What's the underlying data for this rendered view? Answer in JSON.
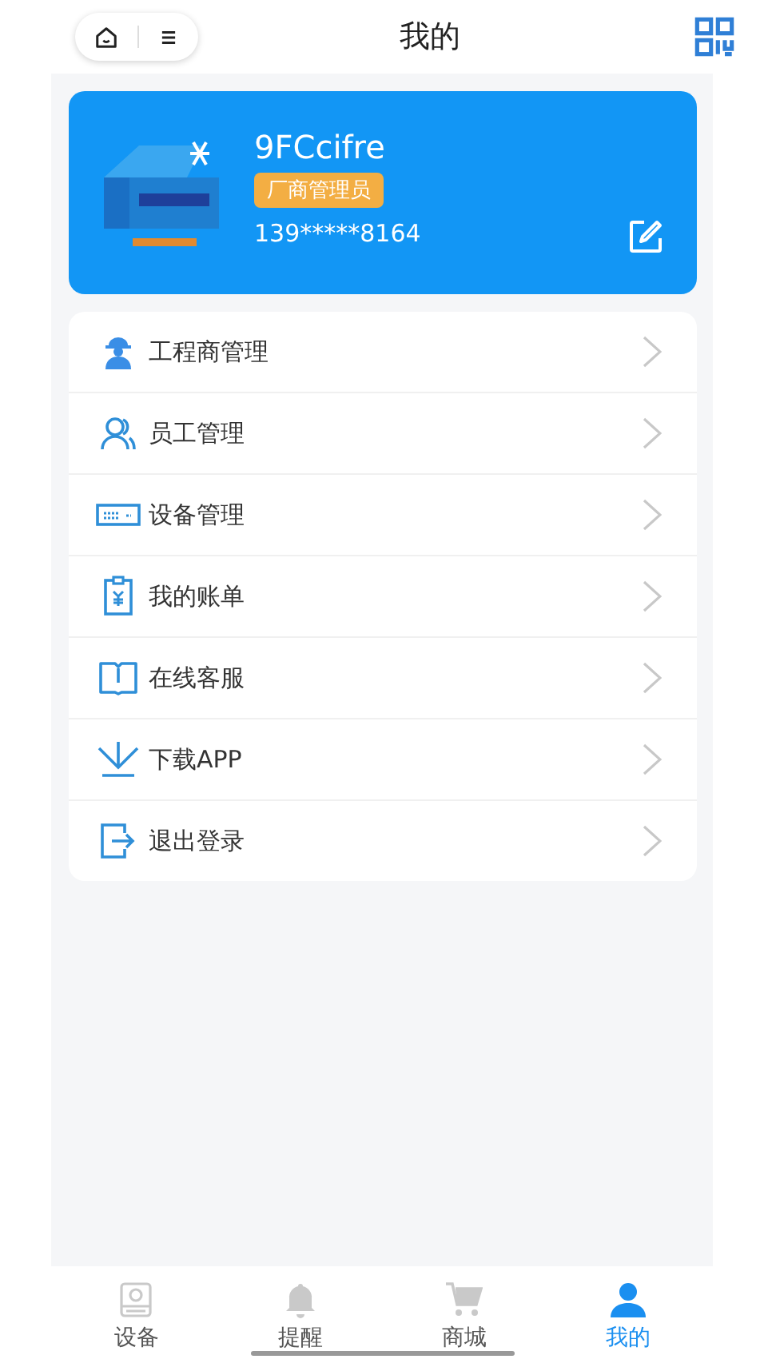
{
  "header": {
    "title": "我的"
  },
  "profile": {
    "name": "9FCcifre",
    "role": "厂商管理员",
    "phone": "139*****8164"
  },
  "menu": [
    {
      "label": "工程商管理"
    },
    {
      "label": "员工管理"
    },
    {
      "label": "设备管理"
    },
    {
      "label": "我的账单"
    },
    {
      "label": "在线客服"
    },
    {
      "label": "下载APP"
    },
    {
      "label": "退出登录"
    }
  ],
  "tabbar": [
    {
      "label": "设备",
      "selected": false
    },
    {
      "label": "提醒",
      "selected": false
    },
    {
      "label": "商城",
      "selected": false
    },
    {
      "label": "我的",
      "selected": true
    }
  ]
}
